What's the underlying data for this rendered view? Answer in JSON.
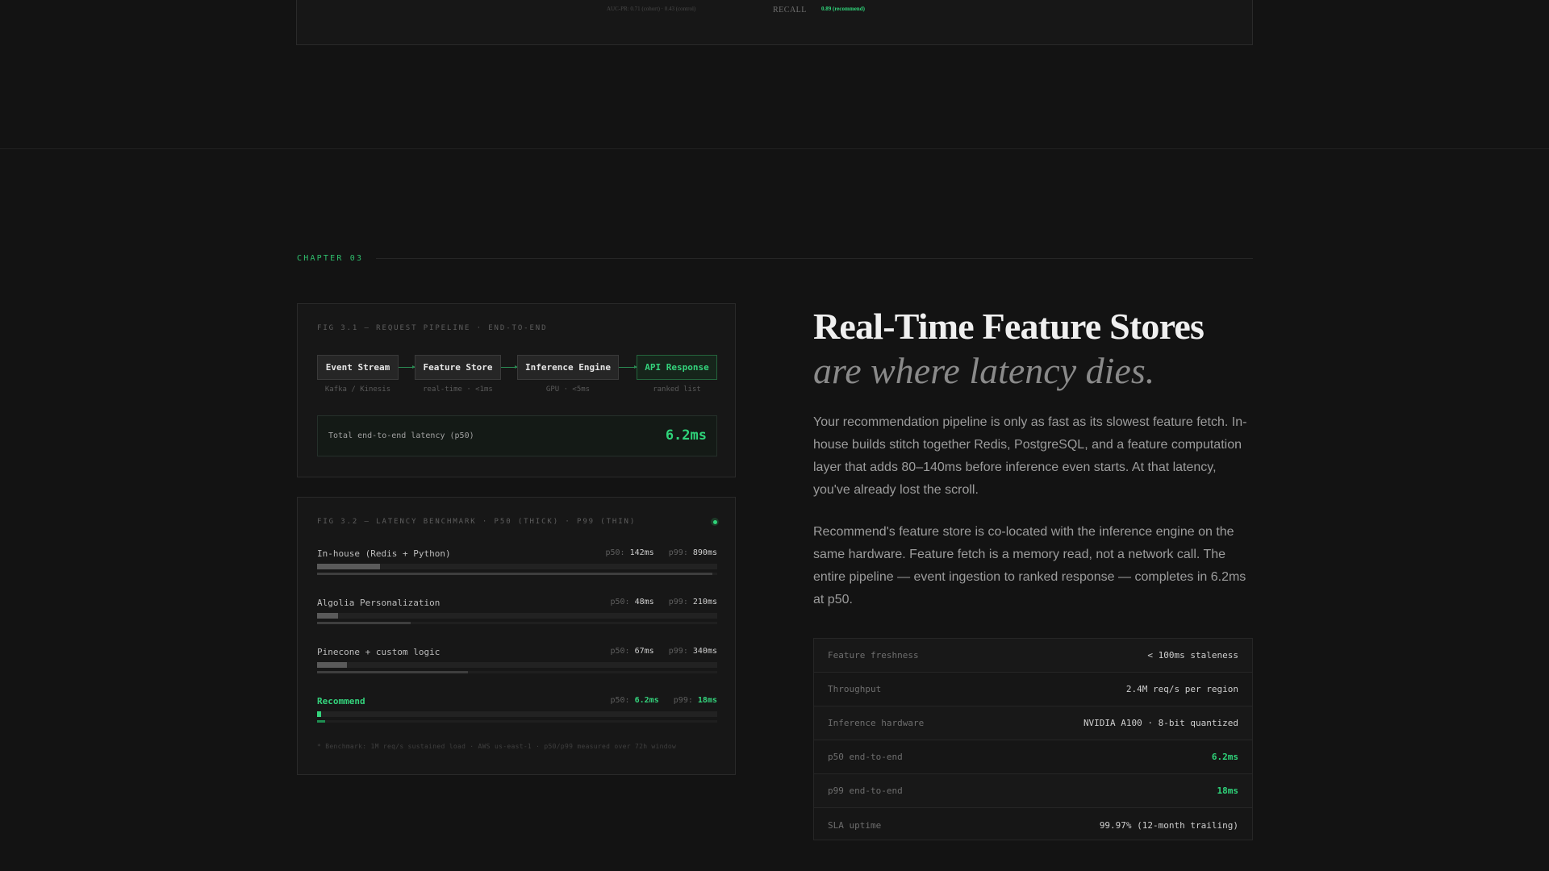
{
  "top_card": {
    "caption": "AUC-PR: 0.71 (cohort) · 0.43 (control)",
    "recall_label": "RECALL",
    "recall_value": "0.89 (recommend)"
  },
  "chapter": {
    "label": "CHAPTER 03"
  },
  "fig1": {
    "title": "FIG 3.1 — REQUEST PIPELINE · END-TO-END",
    "stages": [
      {
        "label": "Event Stream",
        "sub": "Kafka / Kinesis"
      },
      {
        "label": "Feature Store",
        "sub": "real-time · <1ms"
      },
      {
        "label": "Inference Engine",
        "sub": "GPU · <5ms"
      },
      {
        "label": "API Response",
        "sub": "ranked list"
      }
    ],
    "total_label": "Total end-to-end latency (p50)",
    "total_value": "6.2ms"
  },
  "fig2": {
    "title": "FIG 3.2 — LATENCY BENCHMARK · P50 (THICK) · P99 (THIN)",
    "scale_max_ms": 900,
    "p50_prefix": "p50:",
    "p99_prefix": "p99:",
    "rows": [
      {
        "name": "In-house (Redis + Python)",
        "p50": "142ms",
        "p99": "890ms",
        "p50_ms": 142,
        "p99_ms": 890
      },
      {
        "name": "Algolia Personalization",
        "p50": "48ms",
        "p99": "210ms",
        "p50_ms": 48,
        "p99_ms": 210
      },
      {
        "name": "Pinecone + custom logic",
        "p50": "67ms",
        "p99": "340ms",
        "p50_ms": 67,
        "p99_ms": 340
      },
      {
        "name": "Recommend",
        "p50": "6.2ms",
        "p99": "18ms",
        "p50_ms": 6.2,
        "p99_ms": 18
      }
    ],
    "footnote": "* Benchmark: 1M req/s sustained load · AWS us-east-1 · p50/p99 measured over 72h window"
  },
  "headline": {
    "line1": "Real-Time Feature Stores",
    "line2": "are where latency dies."
  },
  "paragraphs": [
    "Your recommendation pipeline is only as fast as its slowest feature fetch. In-house builds stitch together Redis, PostgreSQL, and a feature computation layer that adds 80–140ms before inference even starts. At that latency, you've already lost the scroll.",
    "Recommend's feature store is co-located with the inference engine on the same hardware. Feature fetch is a memory read, not a network call. The entire pipeline — event ingestion to ranked response — completes in 6.2ms at p50."
  ],
  "specs": [
    {
      "key": "Feature freshness",
      "value": "< 100ms staleness"
    },
    {
      "key": "Throughput",
      "value": "2.4M req/s per region"
    },
    {
      "key": "Inference hardware",
      "value": "NVIDIA A100 · 8-bit quantized"
    },
    {
      "key": "p50 end-to-end",
      "value": "6.2ms"
    },
    {
      "key": "p99 end-to-end",
      "value": "18ms"
    },
    {
      "key": "SLA uptime",
      "value": "99.97% (12-month trailing)"
    }
  ],
  "colors": {
    "accent": "#2fd47a",
    "background": "#131313"
  }
}
